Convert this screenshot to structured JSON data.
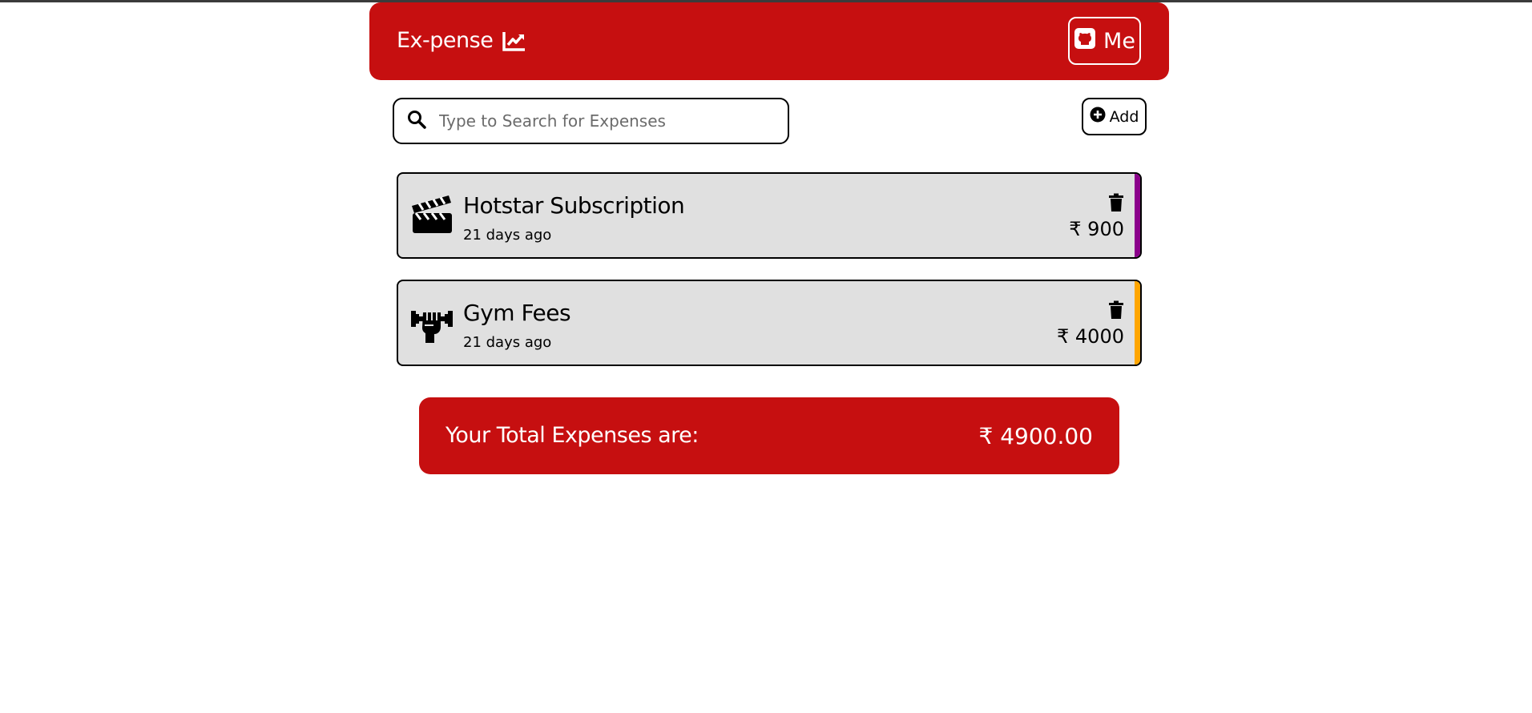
{
  "app": {
    "brand": "Ex-pense",
    "me_label": "Me"
  },
  "search": {
    "placeholder": "Type to Search for Expenses"
  },
  "toolbar": {
    "add_label": "Add"
  },
  "expenses": [
    {
      "title": "Hotstar Subscription",
      "time": "21 days ago",
      "amount": "₹ 900",
      "icon": "clapperboard-icon",
      "accent": "#8b008b"
    },
    {
      "title": "Gym Fees",
      "time": "21 days ago",
      "amount": "₹ 4000",
      "icon": "fist-dumbbell-icon",
      "accent": "#ffa500"
    }
  ],
  "total": {
    "label": "Your Total Expenses are:",
    "value": "₹ 4900.00"
  },
  "colors": {
    "brand": "#c60f10",
    "card": "#e0e0e0"
  }
}
